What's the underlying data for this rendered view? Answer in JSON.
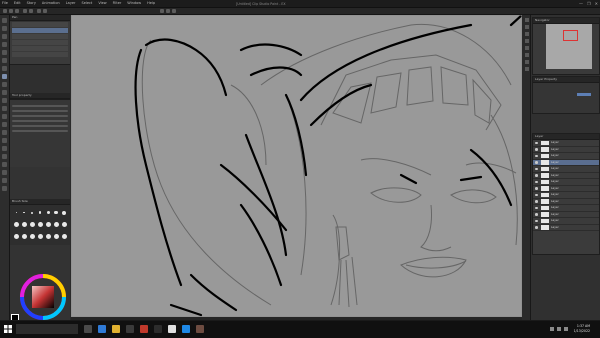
{
  "window": {
    "title": "[Untitled] Clip Studio Paint - EX",
    "menu": [
      "File",
      "Edit",
      "Story",
      "Animation",
      "Layer",
      "Select",
      "View",
      "Filter",
      "Window",
      "Help"
    ],
    "controls": [
      "—",
      "❐",
      "✕"
    ]
  },
  "left_panel": {
    "subtool_header": "Pen",
    "properties_header": "Tool property",
    "brush_size_header": "Brush Size"
  },
  "right_panel": {
    "navigator_header": "Navigator",
    "layer_property_header": "Layer Property",
    "layer_header": "Layer",
    "layers": [
      {
        "name": "Layer",
        "selected": false
      },
      {
        "name": "Layer",
        "selected": false
      },
      {
        "name": "Layer",
        "selected": false
      },
      {
        "name": "Layer",
        "selected": true
      },
      {
        "name": "Layer",
        "selected": false
      },
      {
        "name": "Layer",
        "selected": false
      },
      {
        "name": "Layer",
        "selected": false
      },
      {
        "name": "Layer",
        "selected": false
      },
      {
        "name": "Layer",
        "selected": false
      },
      {
        "name": "Layer",
        "selected": false
      },
      {
        "name": "Layer",
        "selected": false
      },
      {
        "name": "Layer",
        "selected": false
      },
      {
        "name": "Layer",
        "selected": false
      },
      {
        "name": "Layer",
        "selected": false
      }
    ]
  },
  "taskbar": {
    "time": "1:37 AM",
    "date": "1/13/2022"
  },
  "colors": {
    "canvas_bg": "#999999",
    "selection": "#5a6e90",
    "accent_red": "#d33333"
  }
}
